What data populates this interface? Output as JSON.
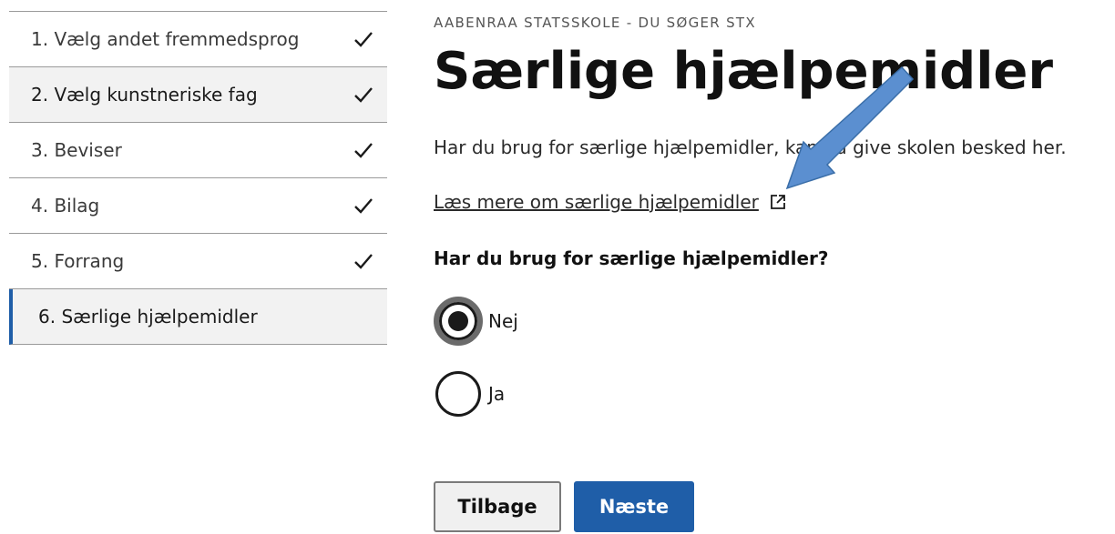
{
  "sidebar": {
    "steps": [
      {
        "label": "1. Vælg andet fremmedsprog",
        "done": true
      },
      {
        "label": "2. Vælg kunstneriske fag",
        "done": true
      },
      {
        "label": "3. Beviser",
        "done": true
      },
      {
        "label": "4. Bilag",
        "done": true
      },
      {
        "label": "5. Forrang",
        "done": true
      },
      {
        "label": "6. Særlige hjælpemidler",
        "done": false,
        "active": true
      }
    ]
  },
  "main": {
    "school": "AABENRAA STATSSKOLE - DU SØGER STX",
    "title": "Særlige hjælpemidler",
    "intro": "Har du brug for særlige hjælpemidler, kan du give skolen besked her.",
    "more_link": "Læs mere om særlige hjælpemidler",
    "question": "Har du brug for særlige hjælpemidler?",
    "options": [
      {
        "label": "Nej",
        "selected": true
      },
      {
        "label": "Ja",
        "selected": false
      }
    ]
  },
  "buttons": {
    "back_label": "Tilbage",
    "next_label": "Næste"
  },
  "icons": {
    "step_done": "check-icon",
    "link_external": "external-link-icon",
    "annotation": "arrow-icon"
  },
  "colors": {
    "accent": "#1f5ea8",
    "annotation_arrow": "#5b8fd0"
  }
}
